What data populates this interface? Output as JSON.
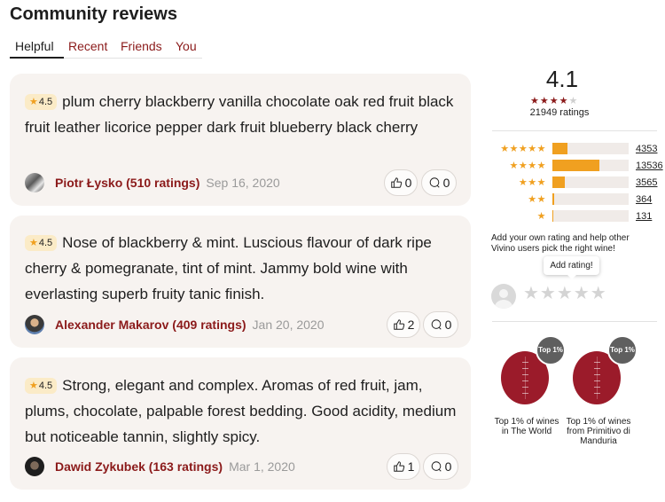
{
  "page": {
    "title": "Community reviews",
    "tabs": [
      {
        "label": "Helpful",
        "active": true
      },
      {
        "label": "Recent",
        "active": false
      },
      {
        "label": "Friends",
        "active": false
      },
      {
        "label": "You",
        "active": false
      }
    ]
  },
  "reviews": [
    {
      "rating": "4.5",
      "text": "plum cherry blackberry vanilla chocolate oak red fruit black fruit leather licorice pepper dark fruit blueberry black cherry",
      "author": "Piotr Łysko (510 ratings)",
      "date": "Sep 16, 2020",
      "likes": "0",
      "comments": "0"
    },
    {
      "rating": "4.5",
      "text": "Nose of blackberry & mint. Luscious flavour of dark ripe cherry & pomegranate, tint of mint. Jammy bold wine with everlasting superb fruity tanic finish.",
      "author": "Alexander Makarov (409 ratings)",
      "date": "Jan 20, 2020",
      "likes": "2",
      "comments": "0"
    },
    {
      "rating": "4.5",
      "text": "Strong, elegant and complex. Aromas of red fruit, jam, plums, chocolate, palpable forest bedding. Good acidity, medium but noticeable tannin, slightly spicy.",
      "author": "Dawid Zykubek (163 ratings)",
      "date": "Mar 1, 2020",
      "likes": "1",
      "comments": "0"
    }
  ],
  "summary": {
    "average": "4.1",
    "filled_stars": 4,
    "total_stars": 5,
    "count_text": "21949 ratings",
    "distribution": [
      {
        "stars": "★★★★★",
        "count": "4353",
        "fraction": 0.2
      },
      {
        "stars": "★★★★",
        "count": "13536",
        "fraction": 0.62
      },
      {
        "stars": "★★★",
        "count": "3565",
        "fraction": 0.16
      },
      {
        "stars": "★★",
        "count": "364",
        "fraction": 0.02
      },
      {
        "stars": "★",
        "count": "131",
        "fraction": 0.01
      }
    ],
    "help_text": "Add your own rating and help other Vivino users pick the right wine!",
    "add_rating_label": "Add rating!",
    "rating_input_stars": "★★★★★"
  },
  "rankings": [
    {
      "badge": "Top 1%",
      "label_line1": "Top 1% of wines",
      "label_line2": "in The World",
      "label_line3": ""
    },
    {
      "badge": "Top 1%",
      "label_line1": "Top 1% of wines",
      "label_line2": "from Primitivo di",
      "label_line3": "Manduria"
    }
  ],
  "colors": {
    "accent": "#8b1a1a",
    "star": "#f0a020",
    "card_bg": "#f7f3f0",
    "rank_circle": "#9b1b2a",
    "rank_badge": "#5f5f5f"
  }
}
